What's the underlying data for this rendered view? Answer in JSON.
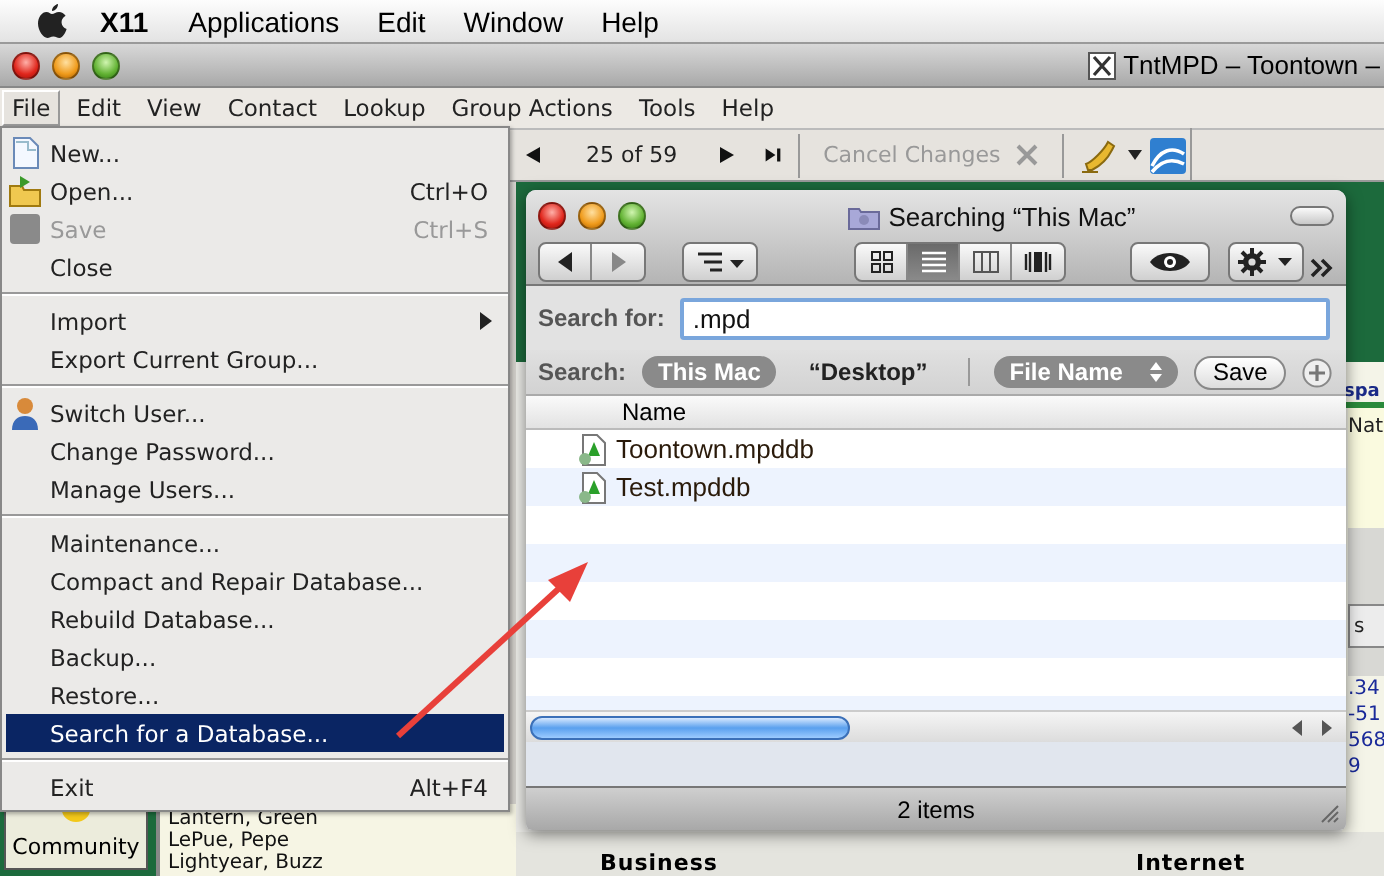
{
  "system_menu_bar": {
    "app_name": "X11",
    "items": [
      "Applications",
      "Edit",
      "Window",
      "Help"
    ]
  },
  "window": {
    "title": "TntMPD – Toontown –"
  },
  "menu_bar": [
    {
      "label": "File",
      "selected": true
    },
    {
      "label": "Edit",
      "selected": false
    },
    {
      "label": "View",
      "selected": false
    },
    {
      "label": "Contact",
      "selected": false
    },
    {
      "label": "Lookup",
      "selected": false
    },
    {
      "label": "Group Actions",
      "selected": false
    },
    {
      "label": "Tools",
      "selected": false
    },
    {
      "label": "Help",
      "selected": false
    }
  ],
  "toolbar": {
    "position": "25 of 59",
    "cancel": {
      "label": "Cancel Changes",
      "disabled": true
    }
  },
  "file_menu": [
    {
      "kind": "item",
      "label": "New...",
      "selected": false,
      "disabled": false
    },
    {
      "kind": "item",
      "label": "Open...",
      "shortcut": "Ctrl+O",
      "selected": false,
      "disabled": false
    },
    {
      "kind": "item",
      "label": "Save",
      "shortcut": "Ctrl+S",
      "selected": false,
      "disabled": true
    },
    {
      "kind": "item",
      "label": "Close",
      "selected": false,
      "disabled": false
    },
    {
      "kind": "separator"
    },
    {
      "kind": "submenu",
      "label": "Import",
      "selected": false,
      "disabled": false
    },
    {
      "kind": "item",
      "label": "Export Current Group...",
      "selected": false,
      "disabled": false
    },
    {
      "kind": "separator"
    },
    {
      "kind": "item",
      "label": "Switch User...",
      "selected": false,
      "disabled": false
    },
    {
      "kind": "item",
      "label": "Change Password...",
      "selected": false,
      "disabled": false
    },
    {
      "kind": "item",
      "label": "Manage Users...",
      "selected": false,
      "disabled": false
    },
    {
      "kind": "separator"
    },
    {
      "kind": "item",
      "label": "Maintenance...",
      "selected": false,
      "disabled": false
    },
    {
      "kind": "item",
      "label": "Compact and Repair Database...",
      "selected": false,
      "disabled": false
    },
    {
      "kind": "item",
      "label": "Rebuild Database...",
      "selected": false,
      "disabled": false
    },
    {
      "kind": "item",
      "label": "Backup...",
      "selected": false,
      "disabled": false
    },
    {
      "kind": "item",
      "label": "Restore...",
      "selected": false,
      "disabled": false
    },
    {
      "kind": "item",
      "label": "Search for a Database...",
      "selected": true,
      "disabled": false
    },
    {
      "kind": "separator"
    },
    {
      "kind": "item",
      "label": "Exit",
      "shortcut": "Alt+F4",
      "selected": false,
      "disabled": false
    }
  ],
  "sidebar": {
    "community_button": "Community",
    "contacts": [
      "Lantern, Green",
      "LePue, Pepe",
      "Lightyear, Buzz"
    ]
  },
  "main_panel": {
    "heading": "spa",
    "text": "Nat",
    "tab": "s",
    "numbers": [
      ".34",
      "-51",
      "568",
      "9"
    ],
    "sections": [
      "Business",
      "Internet"
    ]
  },
  "finder": {
    "title": "Searching “This Mac”",
    "views": [
      {
        "kind": "icon",
        "selected": false
      },
      {
        "kind": "list",
        "selected": true
      },
      {
        "kind": "column",
        "selected": false
      },
      {
        "kind": "coverflow",
        "selected": false
      }
    ],
    "search_label": "Search for:",
    "query": ".mpd",
    "scope_label": "Search:",
    "scopes": [
      {
        "label": "This Mac",
        "selected": true
      },
      {
        "label": "“Desktop”",
        "selected": false
      }
    ],
    "criterion": "File Name",
    "save_button": "Save",
    "column_header": "Name",
    "files": [
      "Toontown.mpddb",
      "Test.mpddb"
    ],
    "status": "2 items"
  }
}
